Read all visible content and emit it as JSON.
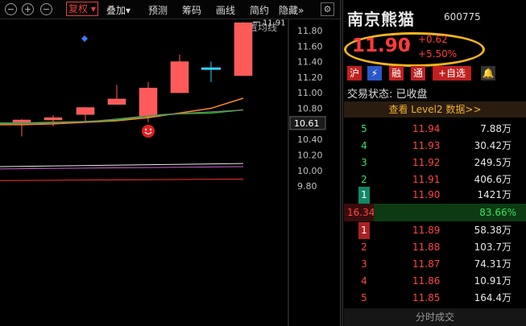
{
  "toolbar": {
    "icons": [
      "minus-circle-icon",
      "plus-circle-icon",
      "minus-circle-icon"
    ],
    "menus": [
      "复权",
      "叠加",
      "预测",
      "筹码",
      "画线",
      "简约",
      "隐藏"
    ],
    "more_glyph": "»",
    "gear_icon": "gear-icon"
  },
  "chart": {
    "ma_setting_label": "设置均线",
    "high_label": "11.91",
    "current_label": "10.61",
    "y_axis_labels": [
      "11.80",
      "11.60",
      "11.40",
      "11.20",
      "11.00",
      "10.80",
      "10.60",
      "10.40",
      "10.20",
      "10.00",
      "9.80"
    ],
    "smile_icon": "smiley-icon",
    "colors": {
      "up": "#ff5a5a",
      "ma_orange": "#ff8a2a",
      "ma_green": "#2ec02e",
      "vol_pink": "#d060d0",
      "vol_white": "#e8e8e8",
      "vol_red": "#ff3030",
      "doji": "#30d0ff"
    }
  },
  "chart_data": {
    "type": "candlestick",
    "candles": [
      {
        "open": 10.62,
        "close": 10.65,
        "high": 10.66,
        "low": 10.44
      },
      {
        "open": 10.65,
        "close": 10.68,
        "high": 10.71,
        "low": 10.57
      },
      {
        "open": 10.72,
        "close": 10.81,
        "high": 10.81,
        "low": 10.63
      },
      {
        "open": 10.85,
        "close": 10.92,
        "high": 11.1,
        "low": 10.85
      },
      {
        "open": 10.69,
        "close": 11.06,
        "high": 11.14,
        "low": 10.62
      },
      {
        "open": 11.0,
        "close": 11.4,
        "high": 11.49,
        "low": 11.0
      },
      {
        "open": 11.32,
        "close": 11.31,
        "high": 11.4,
        "low": 11.14
      },
      {
        "open": 11.22,
        "close": 11.9,
        "high": 11.91,
        "low": 11.22
      }
    ],
    "ma_orange": [
      10.59,
      10.6,
      10.62,
      10.64,
      10.68,
      10.74,
      10.8,
      10.93
    ],
    "ma_green": [
      10.61,
      10.62,
      10.63,
      10.65,
      10.7,
      10.73,
      10.74,
      10.78
    ],
    "ylim": [
      9.8,
      11.95
    ]
  },
  "stock": {
    "name": "南京熊猫",
    "code": "600775",
    "price": "11.90",
    "arrow": "⬆",
    "change": "+0.62",
    "change_pct": "+5.50%",
    "badges": [
      "沪",
      "⚡",
      "融",
      "通",
      "+自选"
    ],
    "bell_icon": "bell-icon",
    "trade_status": "交易状态: 已收盘",
    "level2": "查看 Level2 数据>>",
    "asks": [
      {
        "level": "5",
        "price": "11.94",
        "vol": "7.88万"
      },
      {
        "level": "4",
        "price": "11.93",
        "vol": "30.42万"
      },
      {
        "level": "3",
        "price": "11.92",
        "vol": "249.5万"
      },
      {
        "level": "2",
        "price": "11.91",
        "vol": "406.6万"
      },
      {
        "level": "1",
        "price": "11.90",
        "vol": "1421万"
      }
    ],
    "ratio_left": "16.34%",
    "ratio_right": "83.66%",
    "bids": [
      {
        "level": "1",
        "price": "11.89",
        "vol": "58.38万"
      },
      {
        "level": "2",
        "price": "11.88",
        "vol": "103.7万"
      },
      {
        "level": "3",
        "price": "11.87",
        "vol": "74.31万"
      },
      {
        "level": "4",
        "price": "11.86",
        "vol": "10.91万"
      },
      {
        "level": "5",
        "price": "11.85",
        "vol": "164.4万"
      }
    ],
    "footer": "分时成交"
  }
}
